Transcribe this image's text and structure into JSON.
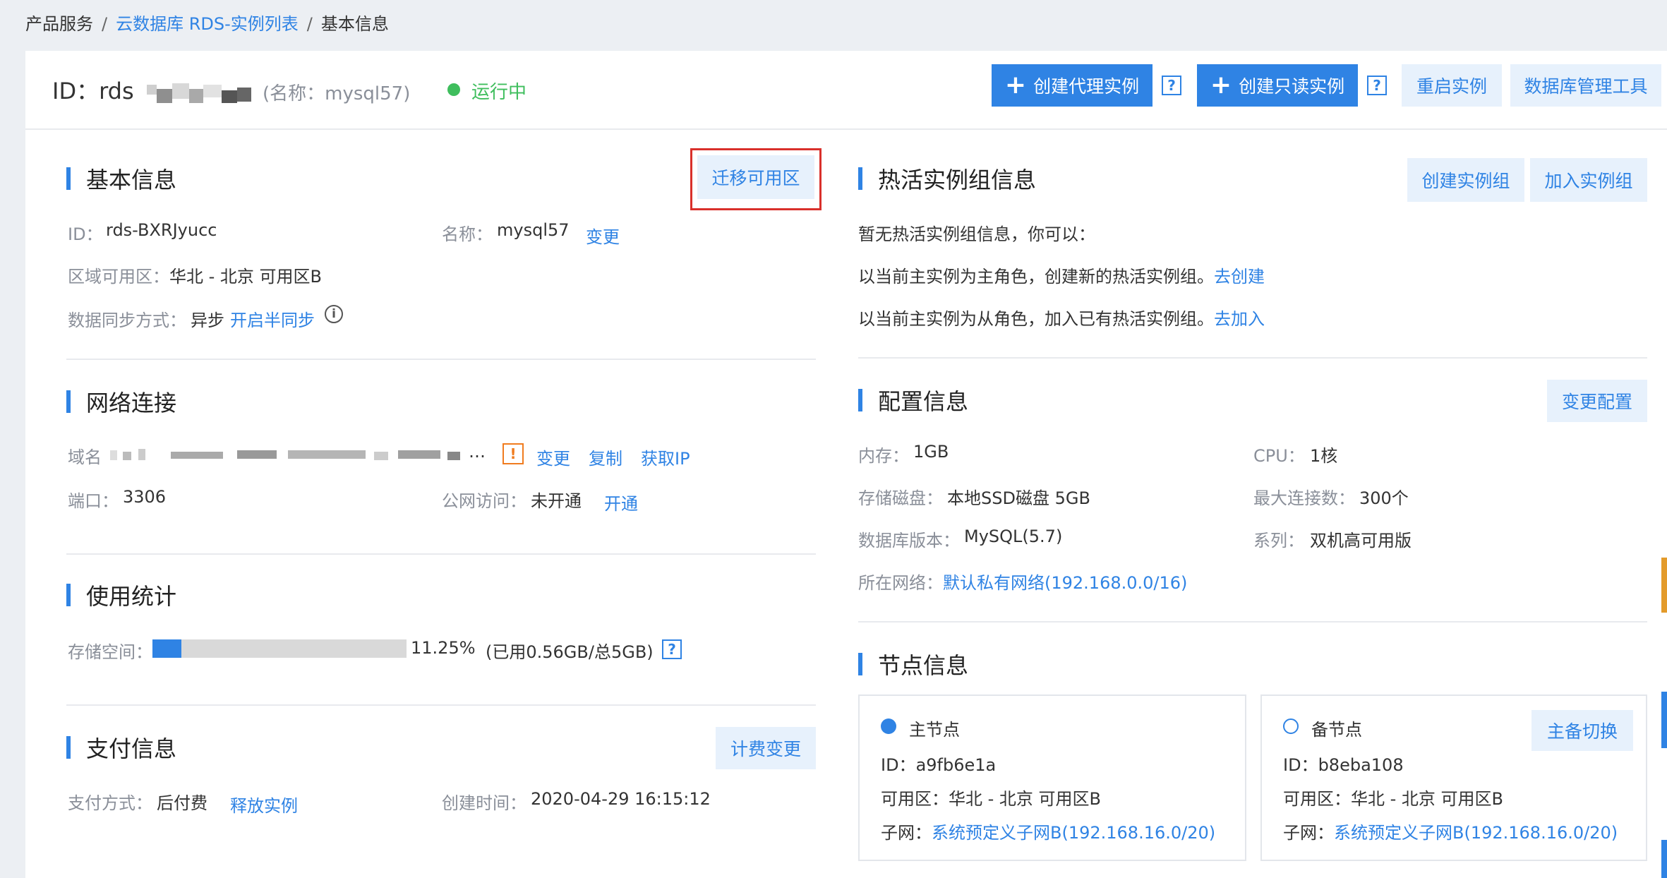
{
  "breadcrumb": {
    "item1": "产品服务",
    "sep": "/",
    "item2": "云数据库 RDS-实例列表",
    "item3": "基本信息"
  },
  "header": {
    "id_prefix": "ID：rds",
    "name": "(名称：mysql57)",
    "status": "运行中",
    "btn_create_proxy": "创建代理实例",
    "btn_create_readonly": "创建只读实例",
    "btn_restart": "重启实例",
    "btn_db_tool": "数据库管理工具",
    "help_q": "?"
  },
  "basic": {
    "title": "基本信息",
    "btn_migrate": "迁移可用区",
    "id_label": "ID：",
    "id_value": "rds-BXRJyucc",
    "name_label": "名称：",
    "name_value": "mysql57",
    "name_change": "变更",
    "zone_label": "区域可用区：",
    "zone_value": "华北 - 北京 可用区B",
    "sync_label": "数据同步方式：",
    "sync_value": "异步",
    "sync_link": "开启半同步",
    "info_icon": "i"
  },
  "network": {
    "title": "网络连接",
    "domain_label": "域名",
    "domain_tail": "…",
    "warn": "!",
    "change": "变更",
    "copy": "复制",
    "get_ip": "获取IP",
    "port_label": "端口：",
    "port_value": "3306",
    "public_label": "公网访问：",
    "public_value": "未开通",
    "public_open": "开通"
  },
  "usage": {
    "title": "使用统计",
    "storage_label": "存储空间：",
    "percent_text": "11.25%",
    "percent": 0.1125,
    "detail": "(已用0.56GB/总5GB)",
    "help_q": "?"
  },
  "payment": {
    "title": "支付信息",
    "btn_change": "计费变更",
    "method_label": "支付方式：",
    "method_value": "后付费",
    "release": "释放实例",
    "created_label": "创建时间：",
    "created_value": "2020-04-29 16:15:12"
  },
  "hot_group": {
    "title": "热活实例组信息",
    "btn_create": "创建实例组",
    "btn_join": "加入实例组",
    "empty_text": "暂无热活实例组信息，你可以：",
    "line1_text": "以当前主实例为主角色，创建新的热活实例组。",
    "line1_link": "去创建",
    "line2_text": "以当前主实例为从角色，加入已有热活实例组。",
    "line2_link": "去加入"
  },
  "config": {
    "title": "配置信息",
    "btn_change": "变更配置",
    "mem_label": "内存：",
    "mem_value": "1GB",
    "cpu_label": "CPU：",
    "cpu_value": "1核",
    "disk_label": "存储磁盘：",
    "disk_value": "本地SSD磁盘 5GB",
    "maxconn_label": "最大连接数：",
    "maxconn_value": "300个",
    "version_label": "数据库版本：",
    "version_value": "MySQL(5.7)",
    "series_label": "系列：",
    "series_value": "双机高可用版",
    "net_label": "所在网络：",
    "net_value": "默认私有网络(192.168.0.0/16)"
  },
  "nodes": {
    "title": "节点信息",
    "primary": {
      "name": "主节点",
      "id_label": "ID：",
      "id_value": "a9fb6e1a",
      "zone_label": "可用区：",
      "zone_value": "华北 - 北京 可用区B",
      "subnet_label": "子网：",
      "subnet_value": "系统预定义子网B(192.168.16.0/20)"
    },
    "standby": {
      "name": "备节点",
      "switch_btn": "主备切换",
      "id_label": "ID：",
      "id_value": "b8eba108",
      "zone_label": "可用区：",
      "zone_value": "华北 - 北京 可用区B",
      "subnet_label": "子网：",
      "subnet_value": "系统预定义子网B(192.168.16.0/20)"
    }
  },
  "colors": {
    "primary": "#2f83e4",
    "success": "#3fbe5d",
    "warning": "#f07c1f",
    "highlight": "#d9302b"
  }
}
